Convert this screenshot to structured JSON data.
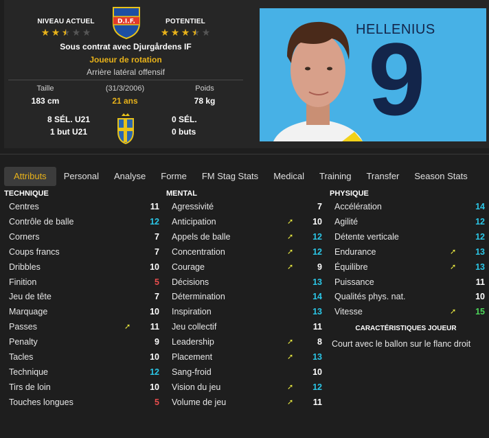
{
  "colors": {
    "accent": "#e8b21a",
    "green": "#4dd65a",
    "teal": "#2bc6e6",
    "red": "#e84d4d",
    "white": "#ffffff",
    "arrow": "#e8e840"
  },
  "header": {
    "current_level_label": "NIVEAU ACTUEL",
    "current_stars": 2.5,
    "potential_label": "POTENTIEL",
    "potential_stars": 3.5,
    "club_badge_text": "D.I.F.",
    "contract": "Sous contrat avec Djurgårdens IF",
    "role": "Joueur de rotation",
    "position": "Arrière latéral offensif",
    "height_label": "Taille",
    "height_value": "183 cm",
    "dob": "(31/3/2006)",
    "age": "21 ans",
    "weight_label": "Poids",
    "weight_value": "78 kg",
    "u21_caps": "8 SÉL. U21",
    "u21_goals": "1 but U21",
    "caps": "0 SÉL.",
    "goals": "0 buts"
  },
  "photo": {
    "name": "HELLENIUS",
    "number": "9"
  },
  "tabs": [
    "Attributs",
    "Personal",
    "Analyse",
    "Forme",
    "FM Stag Stats",
    "Medical",
    "Training",
    "Transfer",
    "Season Stats"
  ],
  "active_tab": 0,
  "technique": {
    "title": "TECHNIQUE",
    "items": [
      {
        "name": "Centres",
        "value": "11",
        "color": "white",
        "arrow": false
      },
      {
        "name": "Contrôle de balle",
        "value": "12",
        "color": "teal",
        "arrow": false
      },
      {
        "name": "Corners",
        "value": "7",
        "color": "white",
        "arrow": false
      },
      {
        "name": "Coups francs",
        "value": "7",
        "color": "white",
        "arrow": false
      },
      {
        "name": "Dribbles",
        "value": "10",
        "color": "white",
        "arrow": false
      },
      {
        "name": "Finition",
        "value": "5",
        "color": "red",
        "arrow": false
      },
      {
        "name": "Jeu de tête",
        "value": "7",
        "color": "white",
        "arrow": false
      },
      {
        "name": "Marquage",
        "value": "10",
        "color": "white",
        "arrow": false
      },
      {
        "name": "Passes",
        "value": "11",
        "color": "white",
        "arrow": true
      },
      {
        "name": "Penalty",
        "value": "9",
        "color": "white",
        "arrow": false
      },
      {
        "name": "Tacles",
        "value": "10",
        "color": "white",
        "arrow": false
      },
      {
        "name": "Technique",
        "value": "12",
        "color": "teal",
        "arrow": false
      },
      {
        "name": "Tirs de loin",
        "value": "10",
        "color": "white",
        "arrow": false
      },
      {
        "name": "Touches longues",
        "value": "5",
        "color": "red",
        "arrow": false
      }
    ]
  },
  "mental": {
    "title": "MENTAL",
    "items": [
      {
        "name": "Agressivité",
        "value": "7",
        "color": "white",
        "arrow": false
      },
      {
        "name": "Anticipation",
        "value": "10",
        "color": "white",
        "arrow": true
      },
      {
        "name": "Appels de balle",
        "value": "12",
        "color": "teal",
        "arrow": true
      },
      {
        "name": "Concentration",
        "value": "12",
        "color": "teal",
        "arrow": true
      },
      {
        "name": "Courage",
        "value": "9",
        "color": "white",
        "arrow": true
      },
      {
        "name": "Décisions",
        "value": "13",
        "color": "teal",
        "arrow": false
      },
      {
        "name": "Détermination",
        "value": "14",
        "color": "teal",
        "arrow": false
      },
      {
        "name": "Inspiration",
        "value": "13",
        "color": "teal",
        "arrow": false
      },
      {
        "name": "Jeu collectif",
        "value": "11",
        "color": "white",
        "arrow": false
      },
      {
        "name": "Leadership",
        "value": "8",
        "color": "white",
        "arrow": true
      },
      {
        "name": "Placement",
        "value": "13",
        "color": "teal",
        "arrow": true
      },
      {
        "name": "Sang-froid",
        "value": "10",
        "color": "white",
        "arrow": false
      },
      {
        "name": "Vision du jeu",
        "value": "12",
        "color": "teal",
        "arrow": true
      },
      {
        "name": "Volume de jeu",
        "value": "11",
        "color": "white",
        "arrow": true
      }
    ]
  },
  "physique": {
    "title": "PHYSIQUE",
    "items": [
      {
        "name": "Accélération",
        "value": "14",
        "color": "teal",
        "arrow": false
      },
      {
        "name": "Agilité",
        "value": "12",
        "color": "teal",
        "arrow": false
      },
      {
        "name": "Détente verticale",
        "value": "12",
        "color": "teal",
        "arrow": false
      },
      {
        "name": "Endurance",
        "value": "13",
        "color": "teal",
        "arrow": true
      },
      {
        "name": "Équilibre",
        "value": "13",
        "color": "teal",
        "arrow": true
      },
      {
        "name": "Puissance",
        "value": "11",
        "color": "white",
        "arrow": false
      },
      {
        "name": "Qualités phys. nat.",
        "value": "10",
        "color": "white",
        "arrow": false
      },
      {
        "name": "Vitesse",
        "value": "15",
        "color": "green",
        "arrow": true
      }
    ]
  },
  "traits": {
    "title": "CARACTÉRISTIQUES JOUEUR",
    "text": "Court avec le ballon sur le flanc droit"
  }
}
